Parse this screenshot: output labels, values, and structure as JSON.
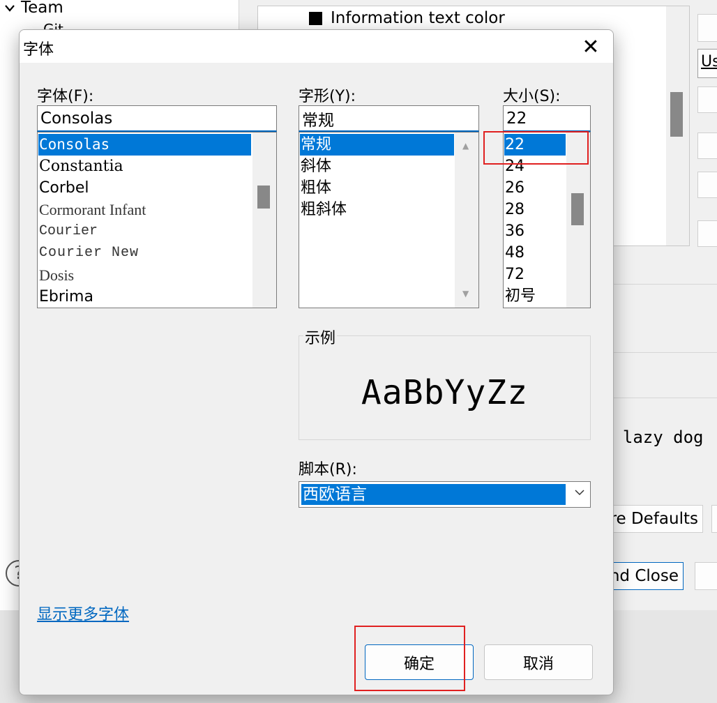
{
  "background": {
    "tree_item": "Team",
    "tree_sub": "Git",
    "color_item": "Information text color",
    "partial_t": "t",
    "preview_text": "e lazy dog",
    "right_button_fragment": "Us",
    "restore_defaults": "re Defaults",
    "apply_close": "nd Close",
    "help_icon": "?"
  },
  "dialog": {
    "title": "字体",
    "close_icon": "✕",
    "font_label": "字体(F):",
    "font_value": "Consolas",
    "font_list": [
      "Consolas",
      "Constantia",
      "Corbel",
      "Cormorant Infant",
      "Courier",
      "Courier New",
      "Dosis",
      "Ebrima"
    ],
    "style_label": "字形(Y):",
    "style_value": "常规",
    "style_list": [
      "常规",
      "斜体",
      "粗体",
      "粗斜体"
    ],
    "size_label": "大小(S):",
    "size_value": "22",
    "size_list": [
      "22",
      "24",
      "26",
      "28",
      "36",
      "48",
      "72",
      "初号"
    ],
    "sample_label": "示例",
    "sample_text": "AaBbYyZz",
    "script_label": "脚本(R):",
    "script_value": "西欧语言",
    "more_fonts_link": "显示更多字体",
    "ok_button": "确定",
    "cancel_button": "取消",
    "highlight_color": "#0078d7",
    "annotation_color": "#e02020"
  }
}
